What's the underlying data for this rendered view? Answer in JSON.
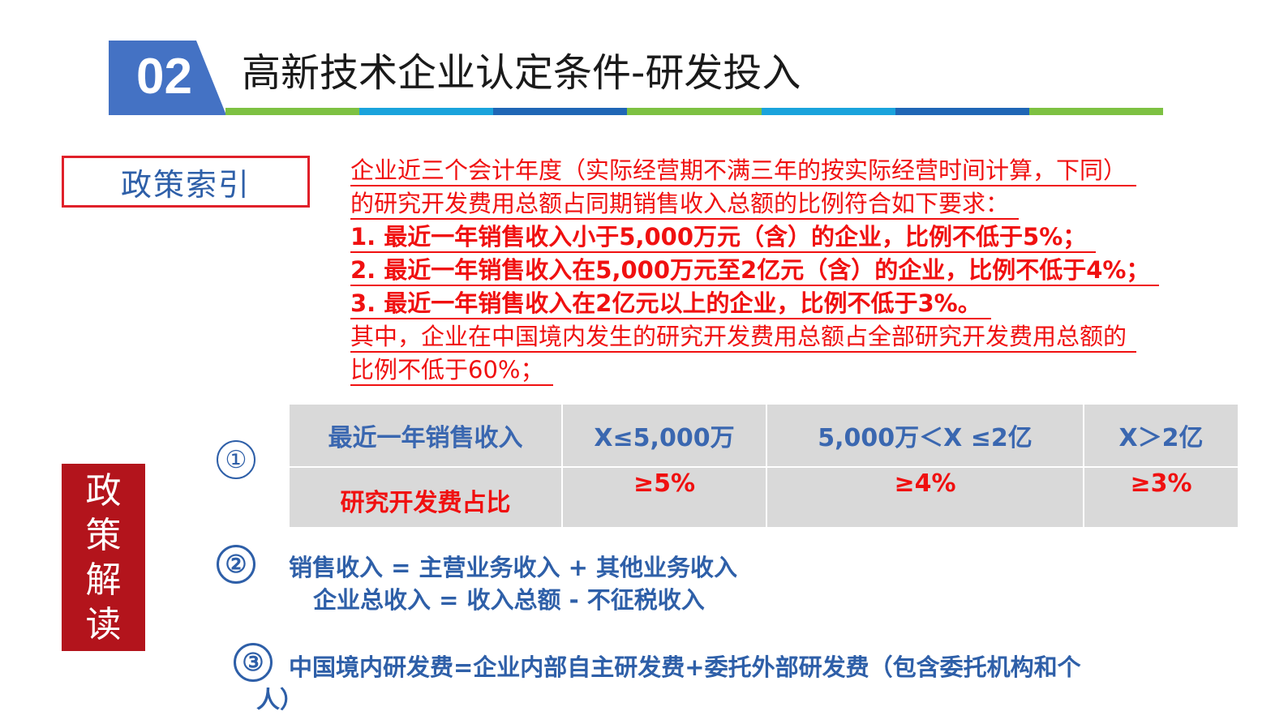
{
  "header": {
    "section_number": "02",
    "title": "高新技术企业认定条件-研发投入",
    "bar_colors": [
      "#7dc142",
      "#1aa3dc",
      "#1f66b5",
      "#7dc142",
      "#1aa3dc",
      "#1f66b5",
      "#7dc142"
    ]
  },
  "policy_index": {
    "label": "政策索引",
    "lines": [
      "企业近三个会计年度（实际经营期不满三年的按实际经营时间计算，下同）",
      "的研究开发费用总额占同期销售收入总额的比例符合如下要求：",
      "1. 最近一年销售收入小于5,000万元（含）的企业，比例不低于5%；",
      "2. 最近一年销售收入在5,000万元至2亿元（含）的企业，比例不低于4%；",
      "3. 最近一年销售收入在2亿元以上的企业，比例不低于3%。",
      "其中，企业在中国境内发生的研究开发费用总额占全部研究开发费用总额的",
      "比例不低于60%；"
    ]
  },
  "interpretation": {
    "label_chars": [
      "政",
      "策",
      "解",
      "读"
    ],
    "item1": {
      "marker": "①",
      "table": {
        "headers": [
          "最近一年销售收入",
          "X≤5,000万",
          "5,000万＜X ≤2亿",
          "X＞2亿"
        ],
        "row": [
          "研究开发费占比",
          "≥5%",
          "≥4%",
          "≥3%"
        ]
      }
    },
    "item2": {
      "marker": "②",
      "line1": "销售收入 = 主营业务收入 + 其他业务收入",
      "line2": "企业总收入 = 收入总额 - 不征税收入"
    },
    "item3": {
      "marker": "③",
      "line1": "中国境内研发费=企业内部自主研发费+委托外部研发费（包含委托机构和个",
      "line2": "人）"
    }
  },
  "colors": {
    "accent_blue": "#4472c4",
    "text_blue": "#2e5fa8",
    "red": "#f01010",
    "badge_red": "#b3141c",
    "table_gray": "#d9d9d9"
  }
}
